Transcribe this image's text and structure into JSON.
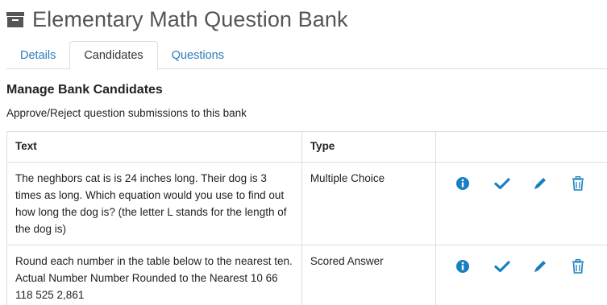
{
  "header": {
    "title": "Elementary Math Question Bank",
    "icon": "archive-box-icon"
  },
  "tabs": [
    {
      "label": "Details",
      "active": false
    },
    {
      "label": "Candidates",
      "active": true
    },
    {
      "label": "Questions",
      "active": false
    }
  ],
  "section": {
    "title": "Manage Bank Candidates",
    "description": "Approve/Reject question submissions to this bank"
  },
  "table": {
    "columns": [
      "Text",
      "Type",
      ""
    ],
    "rows": [
      {
        "text": "The neghbors cat is  is 24 inches long. Their dog is 3 times as long. Which equation would you use to find out how long the dog is? (the letter L stands for the length of the dog is)",
        "type": "Multiple Choice",
        "actions": [
          "info-icon",
          "check-icon",
          "pencil-icon",
          "trash-icon"
        ]
      },
      {
        "text": "Round each number in the table below to the nearest ten. Actual Number Number Rounded to the Nearest 10 66 118 525 2,861",
        "type": "Scored Answer",
        "actions": [
          "info-icon",
          "check-icon",
          "pencil-icon",
          "trash-icon"
        ]
      }
    ]
  },
  "colors": {
    "link": "#2a7ab8",
    "icon": "#1a7fc1",
    "border": "#dddddd",
    "title": "#555555"
  }
}
